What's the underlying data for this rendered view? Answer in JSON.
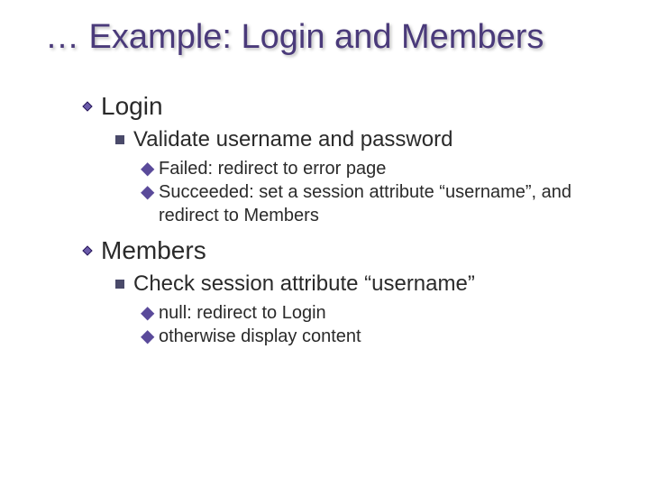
{
  "title": "… Example: Login and Members",
  "sections": [
    {
      "heading": "Login",
      "items": [
        {
          "text": "Validate username and password",
          "subitems": [
            "Failed: redirect to error page",
            "Succeeded: set a session attribute “username”, and redirect to Members"
          ]
        }
      ]
    },
    {
      "heading": "Members",
      "items": [
        {
          "text": "Check session attribute “username”",
          "subitems": [
            "null: redirect to Login",
            "otherwise display content"
          ]
        }
      ]
    }
  ]
}
